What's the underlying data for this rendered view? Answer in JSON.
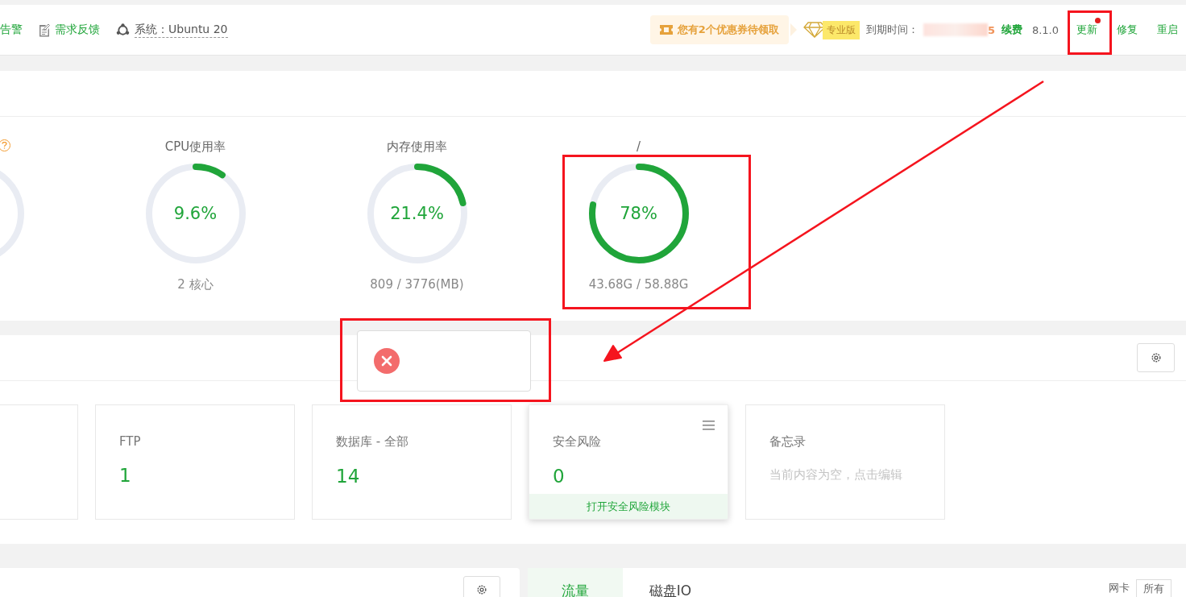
{
  "header": {
    "left_items": [
      {
        "kind": "link",
        "label": "告警"
      },
      {
        "kind": "feedback",
        "label": "需求反馈"
      },
      {
        "kind": "system",
        "label": "系统：Ubuntu 20"
      }
    ],
    "coupon": "您有2个优惠券待领取",
    "edition": "专业版",
    "expiry_label": "到期时间：",
    "expiry_value": "5",
    "renew": "续费",
    "version": "8.1.0",
    "actions": [
      {
        "label": "更新",
        "badge": true
      },
      {
        "label": "修复",
        "badge": false
      },
      {
        "label": "重启",
        "badge": false
      }
    ]
  },
  "gauges": [
    {
      "kind": "cut",
      "help": true
    },
    {
      "kind": "full",
      "title": "CPU使用率",
      "level": 0.096,
      "value": "9.6%",
      "detail": "2 核心"
    },
    {
      "kind": "full",
      "title": "内存使用率",
      "level": 0.214,
      "value": "21.4%",
      "detail": "809 / 3776(MB)"
    },
    {
      "kind": "full",
      "title": "/",
      "level": 0.78,
      "value": "78%",
      "detail": "43.68G / 58.88G"
    }
  ],
  "toast": {
    "kind": "error"
  },
  "cards": [
    {
      "kind": "cut"
    },
    {
      "kind": "stat",
      "title": "FTP",
      "value": "1"
    },
    {
      "kind": "stat",
      "title": "数据库 - 全部",
      "value": "14"
    },
    {
      "kind": "stat",
      "title": "安全风险",
      "value": "0",
      "menu": true,
      "footer": "打开安全风险模块"
    },
    {
      "kind": "memo",
      "title": "备忘录",
      "placeholder": "当前内容为空，点击编辑"
    }
  ],
  "bottom": {
    "tabs": [
      {
        "label": "流量",
        "selected": true
      },
      {
        "label": "磁盘IO",
        "selected": false
      }
    ],
    "filters": [
      "网卡",
      "所有"
    ]
  },
  "annotations": [
    {
      "kind": "box"
    },
    {
      "kind": "box"
    },
    {
      "kind": "box"
    },
    {
      "kind": "arrow"
    }
  ]
}
